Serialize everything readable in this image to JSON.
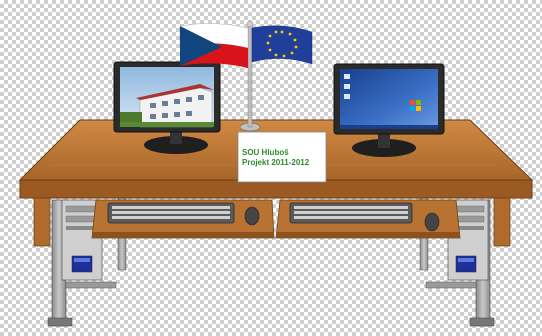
{
  "sign": {
    "line1": "SOU Hluboš",
    "line2": "Projekt 2011-2012"
  },
  "colors": {
    "desk_top": "#b87333",
    "desk_edge": "#8b5220",
    "frame_metal": "#a9a9a9",
    "monitor_bezel": "#2b2b2b",
    "flag_czech_red": "#d7141a",
    "flag_czech_blue": "#11457e",
    "flag_eu_blue": "#1f3f9a",
    "flag_eu_star": "#ffcc00",
    "sign_text": "#2e8b2e",
    "windows_desktop": "#2f5fb0"
  },
  "icons": {
    "left_monitor": "monitor-with-building-photo-icon",
    "right_monitor": "monitor-with-windows-desktop-icon",
    "flags": "czech-and-eu-flags-icon"
  }
}
